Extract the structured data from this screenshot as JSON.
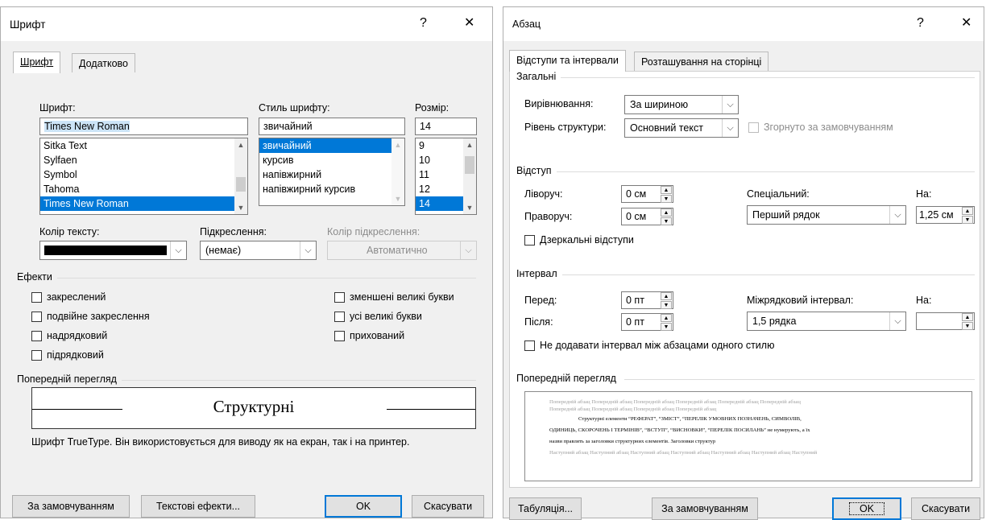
{
  "font_dialog": {
    "title": "Шрифт",
    "help": "?",
    "close": "✕",
    "tabs": [
      "Шрифт",
      "Додатково"
    ],
    "font": {
      "label": "Шрифт:",
      "value": "Times New Roman",
      "list": [
        "Sitka Text",
        "Sylfaen",
        "Symbol",
        "Tahoma",
        "Times New Roman"
      ],
      "selected": "Times New Roman"
    },
    "style": {
      "label": "Стиль шрифту:",
      "value": "звичайний",
      "list": [
        "звичайний",
        "курсив",
        "напівжирний",
        "напівжирний курсив"
      ],
      "selected": "звичайний"
    },
    "size": {
      "label": "Розмір:",
      "value": "14",
      "list": [
        "9",
        "10",
        "11",
        "12",
        "14"
      ],
      "selected": "14"
    },
    "text_color": {
      "label": "Колір тексту:",
      "color": "#000000"
    },
    "underline": {
      "label": "Підкреслення:",
      "value": "(немає)"
    },
    "underline_color": {
      "label": "Колір підкреслення:",
      "value": "Автоматично"
    },
    "effects": {
      "label": "Ефекти",
      "left": [
        "закреслений",
        "подвійне закреслення",
        "надрядковий",
        "підрядковий"
      ],
      "right": [
        "зменшені великі букви",
        "усі великі букви",
        "прихований"
      ]
    },
    "preview": {
      "label": "Попередній перегляд",
      "sample": "Структурні",
      "note": "Шрифт TrueType. Він використовується для виводу як на екран, так і на принтер."
    },
    "buttons": {
      "default": "За замовчуванням",
      "text_effects": "Текстові ефекти...",
      "ok": "OK",
      "cancel": "Скасувати"
    }
  },
  "paragraph_dialog": {
    "title": "Абзац",
    "help": "?",
    "close": "✕",
    "tabs": [
      "Відступи та інтервали",
      "Розташування на сторінці"
    ],
    "general": {
      "label": "Загальні",
      "alignment_label": "Вирівнювання:",
      "alignment": "За шириною",
      "outline_label": "Рівень структури:",
      "outline": "Основний текст",
      "collapsed_label": "Згорнуто за замовчуванням"
    },
    "indent": {
      "label": "Відступ",
      "left_label": "Ліворуч:",
      "left": "0 см",
      "right_label": "Праворуч:",
      "right": "0 см",
      "special_label": "Спеціальний:",
      "special": "Перший рядок",
      "by_label": "На:",
      "by": "1,25 см",
      "mirror_label": "Дзеркальні відступи"
    },
    "spacing": {
      "label": "Інтервал",
      "before_label": "Перед:",
      "before": "0 пт",
      "after_label": "Після:",
      "after": "0 пт",
      "line_label": "Міжрядковий інтервал:",
      "line": "1,5 рядка",
      "at_label": "На:",
      "at": "",
      "no_space_label": "Не додавати інтервал між абзацами одного стилю"
    },
    "preview": {
      "label": "Попередній перегляд",
      "prev_1": "Попередній абзац Попередній абзац Попередній абзац Попередній абзац Попередній абзац Попередній абзац",
      "prev_2": "Попередній абзац Попередній абзац Попередній абзац Попередній абзац",
      "body_1": "Структурні елементи “РЕФЕРАТ”, “ЗМІСТ”, “ПЕРЕЛІК УМОВНИХ ПОЗНАЧЕНЬ, СИМВОЛІВ,",
      "body_2": "ОДИНИЦЬ, СКОРОЧЕНЬ І ТЕРМІНІВ”, “ВСТУП”, “ВИСНОВКИ”, “ПЕРЕЛІК ПОСИЛАНЬ” не нумерують, а їх",
      "body_3": "назви правлять за заголовки структурних елементів. Заголовки структур",
      "next_1": "Наступний абзац Наступний абзац Наступний абзац Наступний абзац Наступний абзац Наступний абзац Наступний"
    },
    "buttons": {
      "tabs": "Табуляція...",
      "default": "За замовчуванням",
      "ok": "OK",
      "cancel": "Скасувати"
    }
  }
}
